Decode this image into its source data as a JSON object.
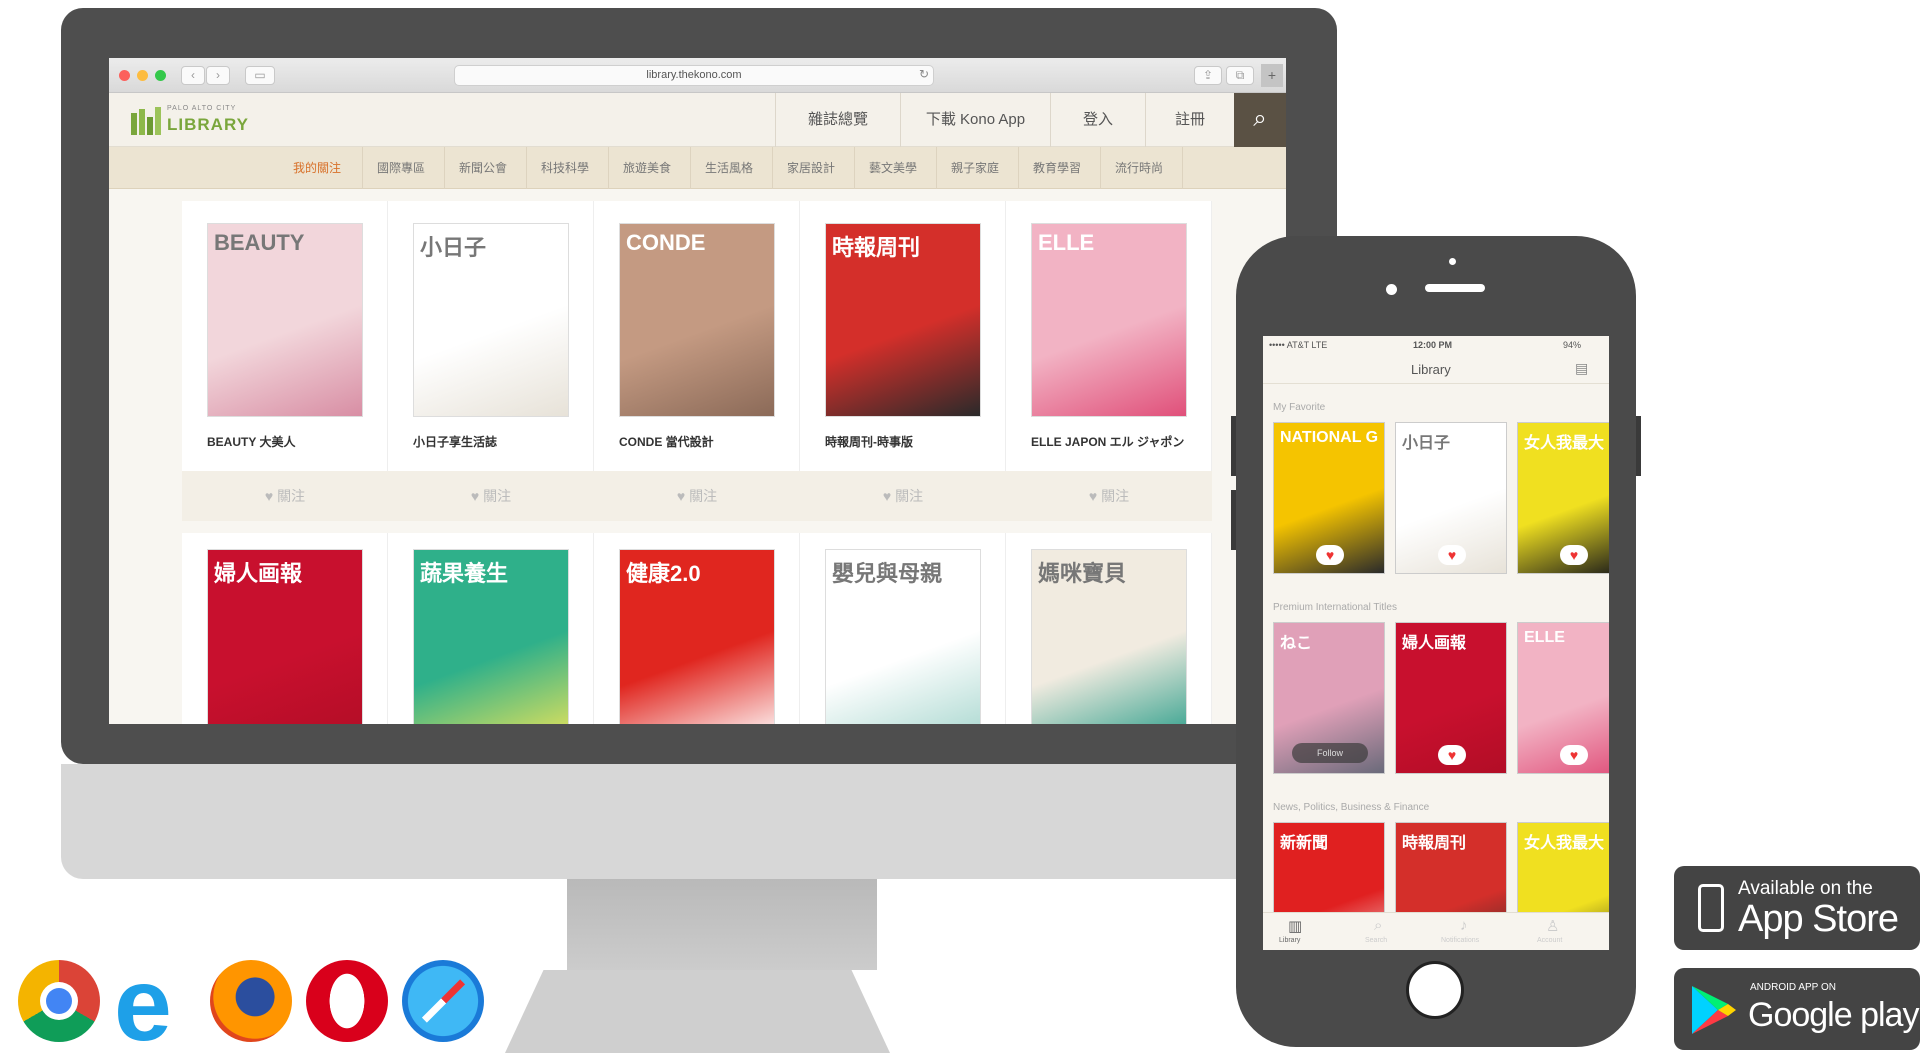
{
  "browser": {
    "url": "library.thekono.com",
    "reload_icon": "reload-icon",
    "share_icon": "share-icon",
    "tabs_icon": "tabs-icon"
  },
  "site": {
    "logo_small": "PALO ALTO CITY",
    "logo_text": "LIBRARY",
    "nav": [
      "雜誌總覽",
      "下載 Kono App",
      "登入",
      "註冊"
    ],
    "search_icon": "search-icon"
  },
  "categories": [
    "我的關注",
    "國際專區",
    "新聞公會",
    "科技科學",
    "旅遊美食",
    "生活風格",
    "家居設計",
    "藝文美學",
    "親子家庭",
    "教育學習",
    "流行時尚"
  ],
  "magazines": [
    {
      "title": "BEAUTY 大美人",
      "cover_text": "BEAUTY",
      "colors": [
        "#f2d6db",
        "#d88ea4"
      ]
    },
    {
      "title": "小日子享生活誌",
      "cover_text": "小日子",
      "colors": [
        "#ffffff",
        "#e7e2d8"
      ]
    },
    {
      "title": "CONDE 當代設計",
      "cover_text": "CONDE",
      "colors": [
        "#c49a82",
        "#8b6a58"
      ]
    },
    {
      "title": "時報周刊-時事版",
      "cover_text": "時報周刊",
      "colors": [
        "#d42f2a",
        "#2a2a2a"
      ]
    },
    {
      "title": "ELLE JAPON エル ジャポン",
      "cover_text": "ELLE",
      "colors": [
        "#f2b3c4",
        "#e0507a"
      ]
    }
  ],
  "magazines_row2": [
    {
      "cover_text": "婦人画報",
      "colors": [
        "#c8102e",
        "#b20d26"
      ]
    },
    {
      "cover_text": "蔬果養生",
      "colors": [
        "#2fb08a",
        "#e8e35a"
      ]
    },
    {
      "cover_text": "健康2.0",
      "colors": [
        "#e0261f",
        "#ffffff"
      ]
    },
    {
      "cover_text": "嬰兒與母親",
      "colors": [
        "#ffffff",
        "#a8d7cf"
      ]
    },
    {
      "cover_text": "媽咪寶貝",
      "colors": [
        "#f1ebe0",
        "#2c9e8a"
      ]
    }
  ],
  "favorite": {
    "label": "關注",
    "icon": "heart-icon"
  },
  "phone": {
    "carrier": "••••• AT&T  LTE",
    "time": "12:00 PM",
    "battery": "94%",
    "title": "Library",
    "sections": [
      "My Favorite",
      "Premium International Titles",
      "News, Politics, Business & Finance"
    ],
    "tabs": [
      "Library",
      "Search",
      "Notifications",
      "Account"
    ],
    "row1": [
      {
        "cover_text": "NATIONAL GEOGRAPHIC",
        "colors": [
          "#f5c400",
          "#2a2a2a"
        ]
      },
      {
        "cover_text": "小日子",
        "colors": [
          "#ffffff",
          "#e7e2d8"
        ]
      },
      {
        "cover_text": "女人我最大",
        "colors": [
          "#f0e020",
          "#1a1a1a"
        ]
      }
    ],
    "row2": [
      {
        "cover_text": "ねこ",
        "colors": [
          "#e0a0b8",
          "#6a6a7a"
        ],
        "button": "Follow"
      },
      {
        "cover_text": "婦人画報",
        "colors": [
          "#c8102e",
          "#b20d26"
        ]
      },
      {
        "cover_text": "ELLE",
        "colors": [
          "#f2b3c4",
          "#e0507a"
        ]
      }
    ],
    "row3": [
      {
        "cover_text": "新新聞",
        "colors": [
          "#e02020",
          "#f2f2f2"
        ]
      },
      {
        "cover_text": "時報周刊",
        "colors": [
          "#d42f2a",
          "#2a2a2a"
        ]
      },
      {
        "cover_text": "女人我最大",
        "colors": [
          "#f0e020",
          "#1a1a1a"
        ]
      }
    ]
  },
  "badges": {
    "appstore_small": "Available on the",
    "appstore_big": "App Store",
    "google_small": "ANDROID APP ON",
    "google_big": "Google play"
  },
  "browser_icons": [
    "chrome-icon",
    "edge-icon",
    "firefox-icon",
    "opera-icon",
    "safari-icon"
  ]
}
